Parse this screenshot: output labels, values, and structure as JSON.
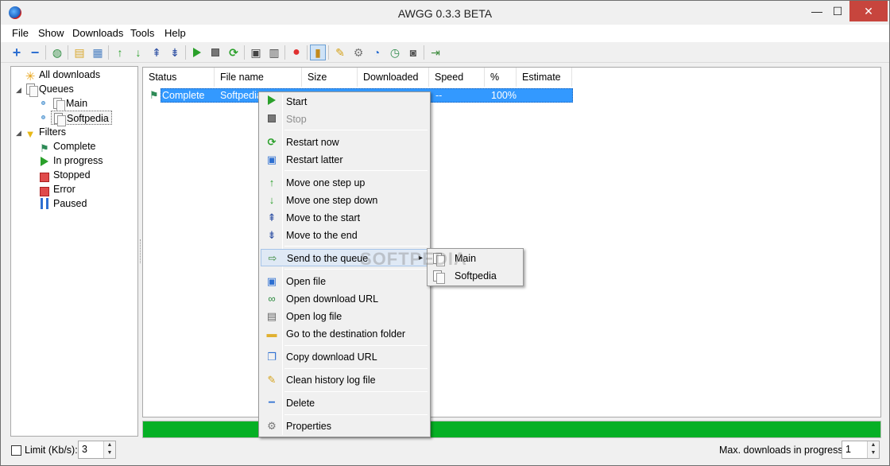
{
  "window": {
    "title": "AWGG 0.3.3 BETA",
    "minimize": "—",
    "maximize": "☐",
    "close": "✕"
  },
  "menubar": [
    "File",
    "Show",
    "Downloads",
    "Tools",
    "Help"
  ],
  "toolbar_icons": [
    "add-icon",
    "remove-icon",
    "globe-icon",
    "folder-open-icon",
    "folder-save-icon",
    "arrow-up-icon",
    "arrow-down-icon",
    "move-top-icon",
    "move-bottom-icon",
    "start-icon",
    "stop-icon",
    "restart-icon",
    "open-file-icon",
    "log-icon",
    "record-icon",
    "clipboard-icon",
    "clean-icon",
    "settings-icon",
    "scheduler-icon",
    "clock-icon",
    "camera-icon",
    "exit-icon"
  ],
  "sidebar": {
    "all_downloads": "All downloads",
    "queues": "Queues",
    "queue_items": [
      "Main",
      "Softpedia"
    ],
    "filters": "Filters",
    "filter_items": [
      "Complete",
      "In progress",
      "Stopped",
      "Error",
      "Paused"
    ]
  },
  "table": {
    "columns": [
      "Status",
      "File name",
      "Size",
      "Downloaded",
      "Speed",
      "%",
      "Estimate"
    ],
    "rows": [
      {
        "status": "Complete",
        "file_name": "Softpedia",
        "speed": "--",
        "percent": "100%"
      }
    ]
  },
  "context_menu": {
    "items": [
      "Start",
      "Stop",
      "Restart now",
      "Restart latter",
      "Move one step up",
      "Move one step down",
      "Move to the start",
      "Move to the end",
      "Send to the queue",
      "Open file",
      "Open download URL",
      "Open log file",
      "Go to the destination folder",
      "Copy download URL",
      "Clean history log file",
      "Delete",
      "Properties"
    ],
    "submenu_arrow": "▸"
  },
  "submenu": {
    "items": [
      "Main",
      "Softpedia"
    ]
  },
  "watermark": "SOFTPEDIA",
  "progress": {
    "fraction": 1.0,
    "color": "#06b025"
  },
  "statusbar": {
    "limit_label": "Limit (Kb/s):",
    "limit_value": "3",
    "max_label": "Max. downloads in progress:",
    "max_value": "1",
    "spin_up": "▲",
    "spin_down": "▼"
  },
  "colors": {
    "selection": "#3399ff",
    "progress": "#06b025",
    "close_button": "#c7453d"
  }
}
